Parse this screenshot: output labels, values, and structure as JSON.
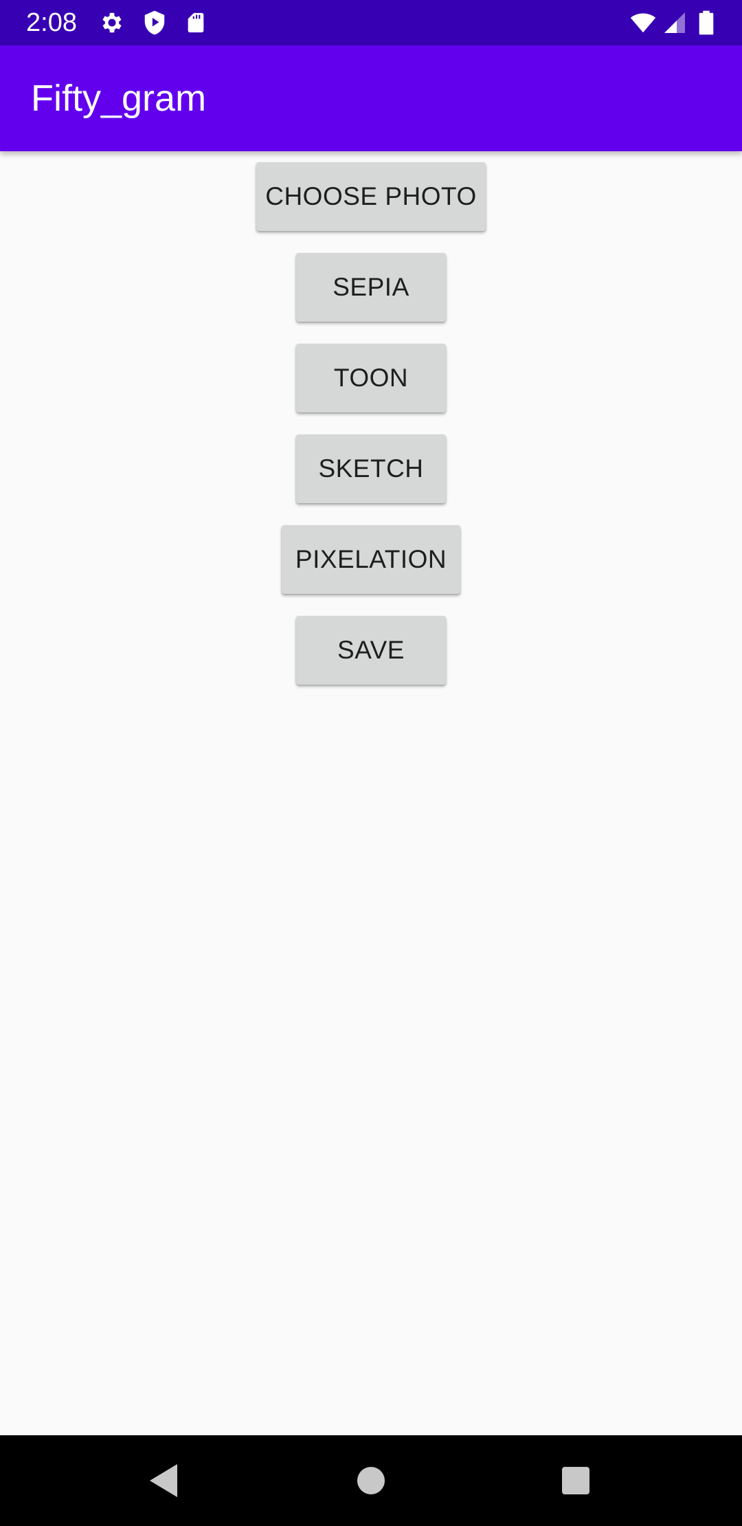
{
  "status_bar": {
    "time": "2:08",
    "icons_left": [
      "gear-icon",
      "shield-play-icon",
      "sd-card-icon"
    ],
    "icons_right": [
      "wifi-icon",
      "cell-signal-icon",
      "battery-icon"
    ],
    "background": "#3700b3"
  },
  "app_bar": {
    "title": "Fifty_gram",
    "background": "#6200ee"
  },
  "buttons": {
    "choose_photo": "CHOOSE PHOTO",
    "sepia": "SEPIA",
    "toon": "TOON",
    "sketch": "SKETCH",
    "pixelation": "PIXELATION",
    "save": "SAVE"
  },
  "nav_bar": {
    "icons": [
      "back-icon",
      "home-icon",
      "recents-icon"
    ],
    "background": "#000000"
  }
}
